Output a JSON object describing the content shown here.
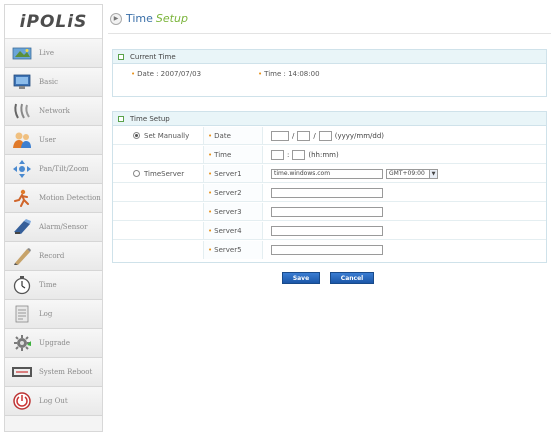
{
  "app": {
    "logo": "iPOLiS"
  },
  "sidebar": {
    "items": [
      {
        "label": "Live",
        "icon": "live-icon"
      },
      {
        "label": "Basic",
        "icon": "monitor-icon"
      },
      {
        "label": "Network",
        "icon": "network-icon"
      },
      {
        "label": "User",
        "icon": "users-icon"
      },
      {
        "label": "Pan/Tilt/Zoom",
        "icon": "ptz-icon"
      },
      {
        "label": "Motion Detection",
        "icon": "motion-icon"
      },
      {
        "label": "Alarm/Sensor",
        "icon": "alarm-icon"
      },
      {
        "label": "Record",
        "icon": "pen-icon"
      },
      {
        "label": "Time",
        "icon": "clock-icon"
      },
      {
        "label": "Log",
        "icon": "log-icon"
      },
      {
        "label": "Upgrade",
        "icon": "upgrade-icon"
      },
      {
        "label": "System Reboot",
        "icon": "reboot-icon"
      },
      {
        "label": "Log Out",
        "icon": "logout-icon"
      }
    ]
  },
  "page": {
    "title_main": "Time",
    "title_sub": "Setup"
  },
  "current_time": {
    "section_title": "Current Time",
    "date_text": "Date : 2007/07/03",
    "time_text": "Time : 14:08:00"
  },
  "time_setup": {
    "section_title": "Time Setup",
    "set_manually_label": "Set Manually",
    "timeserver_label": "TimeServer",
    "date_label": "Date",
    "time_label": "Time",
    "date_sep": "/",
    "date_hint": "(yyyy/mm/dd)",
    "time_sep": ":",
    "time_hint": "(hh:mm)",
    "servers": [
      {
        "label": "Server1",
        "value": "time.windows.com"
      },
      {
        "label": "Server2",
        "value": ""
      },
      {
        "label": "Server3",
        "value": ""
      },
      {
        "label": "Server4",
        "value": ""
      },
      {
        "label": "Server5",
        "value": ""
      }
    ],
    "timezone": "GMT+09:00"
  },
  "buttons": {
    "save": "Save",
    "cancel": "Cancel"
  },
  "colors": {
    "accent": "#3a6fa8",
    "sub_accent": "#7ab43a",
    "bullet": "#e8921a",
    "button": "#1b56a8"
  }
}
